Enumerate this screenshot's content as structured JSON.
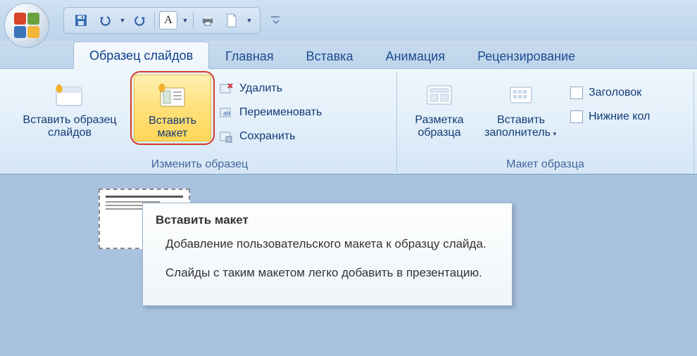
{
  "qat": {
    "items": [
      "save",
      "undo",
      "redo",
      "font",
      "print",
      "new"
    ]
  },
  "tabs": {
    "active": "Образец слайдов",
    "items": [
      "Образец слайдов",
      "Главная",
      "Вставка",
      "Анимация",
      "Рецензирование"
    ]
  },
  "ribbon": {
    "group1": {
      "title": "Изменить образец",
      "insert_master": "Вставить образец слайдов",
      "insert_layout": "Вставить макет",
      "delete": "Удалить",
      "rename": "Переименовать",
      "save": "Сохранить"
    },
    "group2": {
      "title": "Макет образца",
      "master_layout": "Разметка образца",
      "insert_placeholder": "Вставить заполнитель",
      "cb_title": "Заголовок",
      "cb_footer": "Нижние кол"
    }
  },
  "tooltip": {
    "title": "Вставить макет",
    "p1": "Добавление пользовательского макета к образцу слайда.",
    "p2": "Слайды с таким макетом легко добавить в презентацию."
  }
}
